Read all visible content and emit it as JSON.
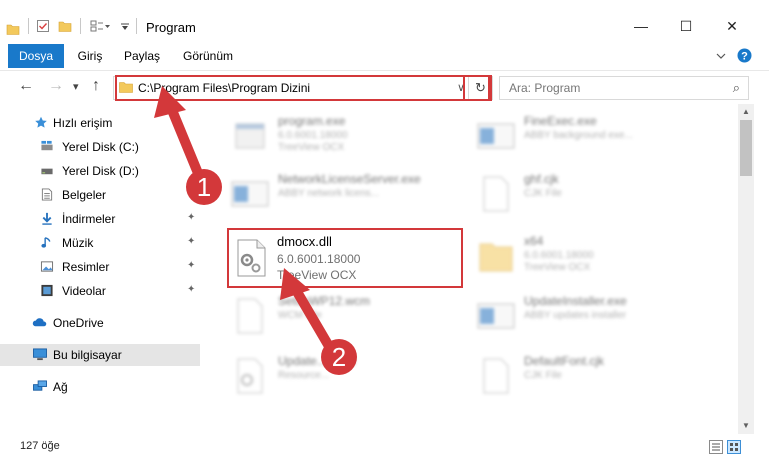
{
  "window": {
    "title": "Program",
    "minimize_label": "—",
    "maximize_label": "☐",
    "close_label": "✕"
  },
  "ribbon": {
    "tabs": [
      {
        "label": "Dosya",
        "active": true
      },
      {
        "label": "Giriş",
        "active": false
      },
      {
        "label": "Paylaş",
        "active": false
      },
      {
        "label": "Görünüm",
        "active": false
      }
    ],
    "expand_icon": "chevron-down-icon",
    "help_icon": "help-icon"
  },
  "addressbar": {
    "path": "C:\\Program Files\\Program Dizini",
    "back_icon": "←",
    "forward_icon": "→",
    "recent_icon": "▾",
    "up_icon": "↑",
    "dropdown_icon": "∨",
    "refresh_icon": "↻"
  },
  "search": {
    "placeholder": "Ara: Program",
    "icon": "⌕"
  },
  "sidebar": {
    "items": [
      {
        "label": "Hızlı erişim",
        "icon": "star-icon",
        "pinned": false
      },
      {
        "label": "Yerel Disk (C:)",
        "icon": "drive-icon",
        "pinned": false
      },
      {
        "label": "Yerel Disk (D:)",
        "icon": "drive-icon",
        "pinned": false
      },
      {
        "label": "Belgeler",
        "icon": "document-icon",
        "pinned": true
      },
      {
        "label": "İndirmeler",
        "icon": "download-icon",
        "pinned": true
      },
      {
        "label": "Müzik",
        "icon": "music-icon",
        "pinned": true
      },
      {
        "label": "Resimler",
        "icon": "picture-icon",
        "pinned": true
      },
      {
        "label": "Videolar",
        "icon": "video-icon",
        "pinned": true
      },
      {
        "label": "OneDrive",
        "icon": "cloud-icon",
        "pinned": false
      },
      {
        "label": "Bu bilgisayar",
        "icon": "computer-icon",
        "pinned": false
      },
      {
        "label": "Ağ",
        "icon": "network-icon",
        "pinned": false
      }
    ],
    "pin_glyph": "📌"
  },
  "files": {
    "left": [
      {
        "name": "program.exe",
        "line1": "6.0.6001.18000",
        "line2": "TreeView OCX"
      },
      {
        "name": "NetworkLicenseServer.exe",
        "line1": "ABBY network licens...",
        "line2": ""
      },
      {
        "name": "SetupWP12.wcm",
        "line1": "WCM File",
        "line2": ""
      },
      {
        "name": "Update.....5.dll",
        "line1": "Resource...",
        "line2": ""
      }
    ],
    "right": [
      {
        "name": "FineExec.exe",
        "line1": "ABBY background exe...",
        "line2": ""
      },
      {
        "name": "ghf.cjk",
        "line1": "CJK File",
        "line2": ""
      },
      {
        "name": "x64",
        "line1": "6.0.6001.18000",
        "line2": "TreeView OCX"
      },
      {
        "name": "UpdateInstaller.exe",
        "line1": "ABBY updates installer",
        "line2": ""
      },
      {
        "name": "DefaultFont.cjk",
        "line1": "CJK File",
        "line2": ""
      }
    ],
    "highlighted": {
      "name": "dmocx.dll",
      "line1": "6.0.6001.18000",
      "line2": "TreeView OCX"
    }
  },
  "statusbar": {
    "count": "127 öğe"
  },
  "annotations": {
    "badge1": "1",
    "badge2": "2",
    "color": "#d3383a"
  }
}
